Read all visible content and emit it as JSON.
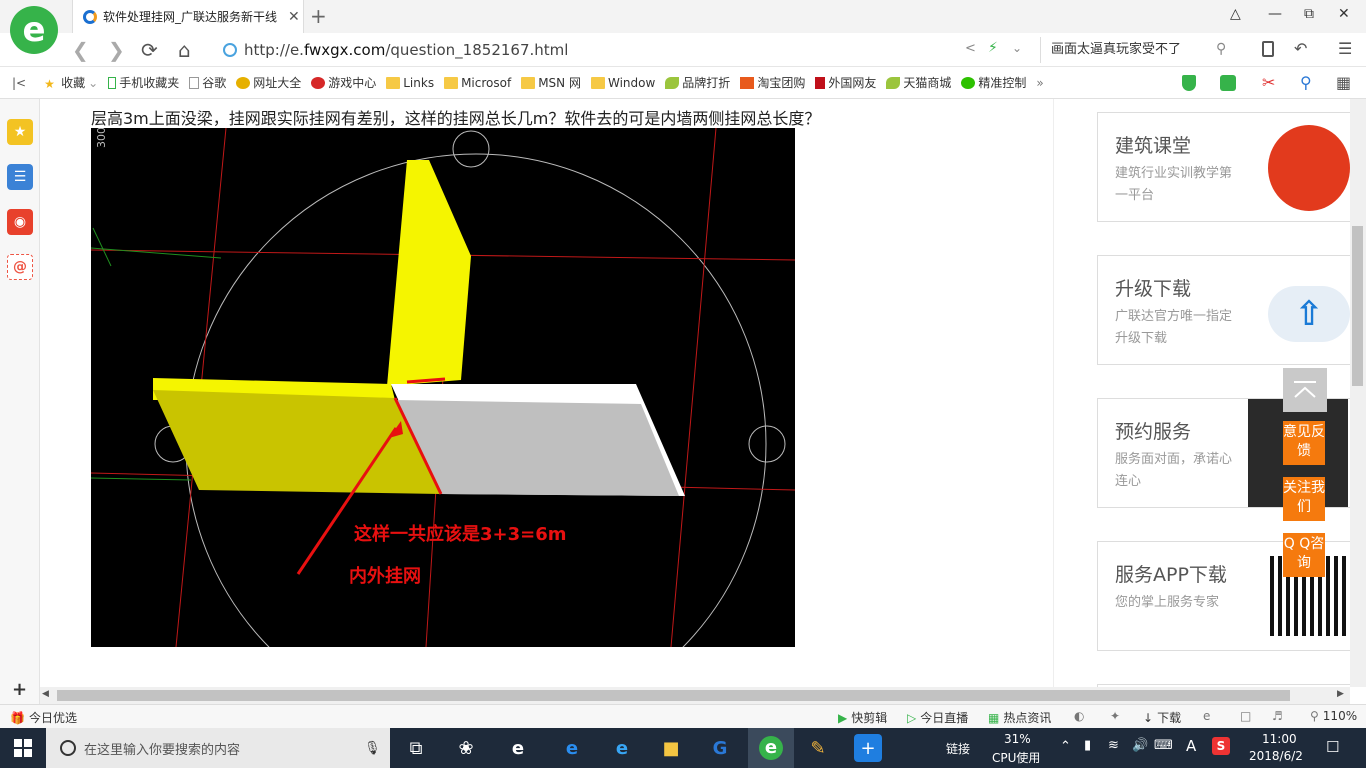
{
  "browser": {
    "tab_title": "软件处理挂网_广联达服务新干线",
    "tab_close": "✕",
    "new_tab": "+",
    "url_prefix": "http://e.",
    "url_domain": "fwxgx.com",
    "url_path": "/question_1852167.html",
    "search_text": "画面太逼真玩家受不了"
  },
  "bookmarks": [
    {
      "label": "收藏",
      "icon": "star-icon"
    },
    {
      "label": "手机收藏夹",
      "icon": "phone-icon"
    },
    {
      "label": "谷歌",
      "icon": "page-icon"
    },
    {
      "label": "网址大全",
      "icon": "globe-icon"
    },
    {
      "label": "游戏中心",
      "icon": "game-icon"
    },
    {
      "label": "Links",
      "icon": "folder-icon"
    },
    {
      "label": "Microsof",
      "icon": "folder-icon"
    },
    {
      "label": "MSN 网",
      "icon": "folder-icon"
    },
    {
      "label": "Window",
      "icon": "folder-icon"
    },
    {
      "label": "品牌打折",
      "icon": "leaf-icon"
    },
    {
      "label": "淘宝团购",
      "icon": "taobao-icon"
    },
    {
      "label": "外国网友",
      "icon": "flag-icon"
    },
    {
      "label": "天猫商城",
      "icon": "leaf-icon"
    },
    {
      "label": "精准控制",
      "icon": "wechat-icon"
    }
  ],
  "page": {
    "question": "层高3m上面没梁，挂网跟实际挂网有差别，这样的挂网总长几m？软件去的可是内墙两侧挂网总长度？",
    "cad_axis_label": "300",
    "annotation_line1": "这样一共应该是3+3=6m",
    "annotation_line2": "内外挂网"
  },
  "right_cards": [
    {
      "title": "建筑课堂",
      "sub": "建筑行业实训教学第一平台"
    },
    {
      "title": "升级下载",
      "sub": "广联达官方唯一指定升级下载"
    },
    {
      "title": "预约服务",
      "sub": "服务面对面，承诺心连心"
    },
    {
      "title": "服务APP下载",
      "sub": "您的掌上服务专家"
    }
  ],
  "float_buttons": [
    "意见反馈",
    "关注我们",
    "Q Q咨询"
  ],
  "status": {
    "today": "今日优选",
    "items": [
      "快剪辑",
      "今日直播",
      "热点资讯",
      "下载"
    ],
    "zoom": "110%"
  },
  "taskbar": {
    "search_placeholder": "在这里输入你要搜索的内容",
    "link_label": "链接",
    "cpu_percent": "31%",
    "cpu_label": "CPU使用",
    "ime": "A",
    "time": "11:00",
    "date": "2018/6/2"
  },
  "colors": {
    "accent_green": "#36b34a",
    "orange": "#f57a0e",
    "annotation_red": "#e81010"
  }
}
